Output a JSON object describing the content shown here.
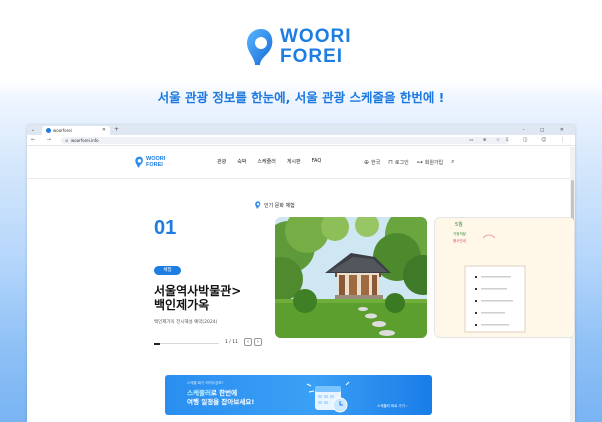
{
  "hero": {
    "logo_line1": "WOORI",
    "logo_line2": "FOREI",
    "tagline": "서울 관광 정보를 한눈에, 서울 관광 스케줄을 한번에 !"
  },
  "browser": {
    "tab_title": "woorforei",
    "url": "woorforei.info",
    "window_controls": "- ◻ ✕"
  },
  "site": {
    "logo_line1": "WOORI",
    "logo_line2": "FOREI",
    "menu": [
      "관광",
      "숙박",
      "스케줄러",
      "게시판",
      "FAQ"
    ],
    "util": {
      "lang": "한국",
      "login": "로그인",
      "signup": "회원가입"
    }
  },
  "main": {
    "section_label": "인기 문화 체험",
    "slide_number": "01",
    "badge": "체험",
    "title_line1": "서울역사박물관>",
    "title_line2": "백인제가옥",
    "subtitle": "백인제가옥 전시해설 예약(2024)",
    "counter": "1 / 11",
    "progress": 0.09,
    "side_card": {
      "tag": "5월",
      "line1": "가정의달",
      "line2": "행사안내"
    }
  },
  "banner": {
    "small": "스케줄 짜기 어려우셨죠?",
    "line1_a": "스케줄러",
    "line1_b": "로 한번에",
    "line2": "여행 일정을 잡아보세요!",
    "cta": "스케줄러 바로 가기 ›"
  },
  "colors": {
    "brand": "#1d7de0",
    "banner": "#2a8ef0"
  }
}
